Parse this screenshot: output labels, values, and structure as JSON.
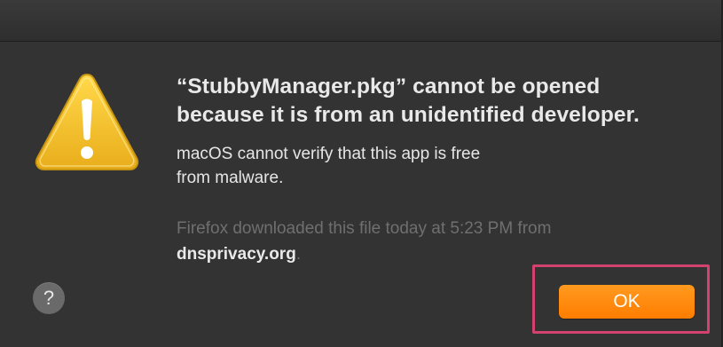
{
  "dialog": {
    "headline_line1": "“StubbyManager.pkg” cannot be opened",
    "headline_line2": "because it is from an unidentified developer.",
    "body_line1": "macOS cannot verify that this app is free",
    "body_line2": "from malware.",
    "source_line1": "Firefox downloaded this file today at 5:23 PM from",
    "source_domain": "dnsprivacy.org",
    "source_suffix": ".",
    "icon": "warning-triangle-icon"
  },
  "buttons": {
    "help_label": "?",
    "ok_label": "OK"
  },
  "colors": {
    "background": "#333333",
    "accent": "#ff8a0d",
    "highlight": "#d3416e",
    "warning_fill": "#f2c230"
  }
}
